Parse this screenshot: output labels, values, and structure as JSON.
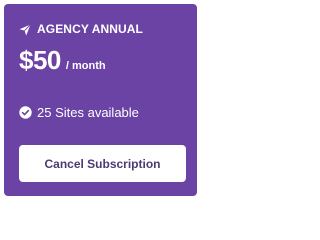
{
  "plan": {
    "name": "AGENCY ANNUAL",
    "icon": "paper-plane-icon",
    "price": "$50",
    "period": "/ month"
  },
  "feature": {
    "icon": "check-circle-icon",
    "text": "25 Sites available"
  },
  "actions": {
    "cancel_label": "Cancel Subscription"
  },
  "colors": {
    "card_background": "#6a43a4",
    "button_text": "#4b3a73",
    "text": "#ffffff"
  }
}
